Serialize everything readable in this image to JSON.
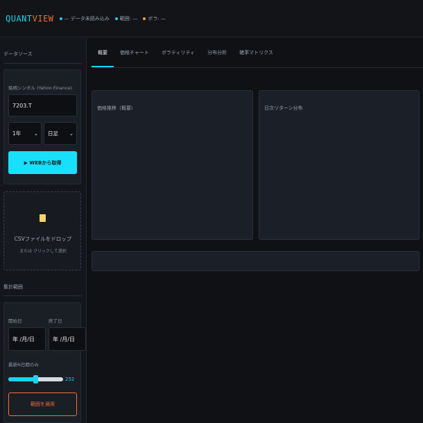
{
  "header": {
    "logo_part1": "QUANT",
    "logo_part2": "VIEW",
    "status": [
      {
        "text": "— データ未読み込み",
        "color": "#19d3f0"
      },
      {
        "text": "範囲: —",
        "color": "#19d3f0"
      },
      {
        "text": "ボラ: —",
        "color": "#f5a623"
      }
    ]
  },
  "sidebar": {
    "data_source_title": "データソース",
    "symbol_label": "銘柄シンボル (Yahoo Finance)",
    "symbol_value": "7203.T",
    "period_value": "1年",
    "interval_value": "日足",
    "fetch_button": "▶ WEBから取得",
    "drop_icon": "folder-icon",
    "drop_title": "CSVファイルをドロップ",
    "drop_subtitle": "または クリックして選択",
    "range_title": "集計範囲",
    "start_label": "開始日",
    "end_label": "終了日",
    "start_value": "年 /月/日",
    "end_value": "年 /月/日",
    "recent_label": "最新N日間のみ",
    "recent_value": "252",
    "recent_fraction": 0.5,
    "apply_button": "範囲を適用"
  },
  "main": {
    "tabs": [
      "概要",
      "価格チャート",
      "ボラティリティ",
      "分布分析",
      "確率マトリクス"
    ],
    "cards": {
      "price_title": "価格推移（概要）",
      "returns_title": "日次リターン分布"
    }
  },
  "colors": {
    "accent": "#19d3f0",
    "brand_orange": "#f2703a",
    "status_yellow": "#f5a623"
  }
}
